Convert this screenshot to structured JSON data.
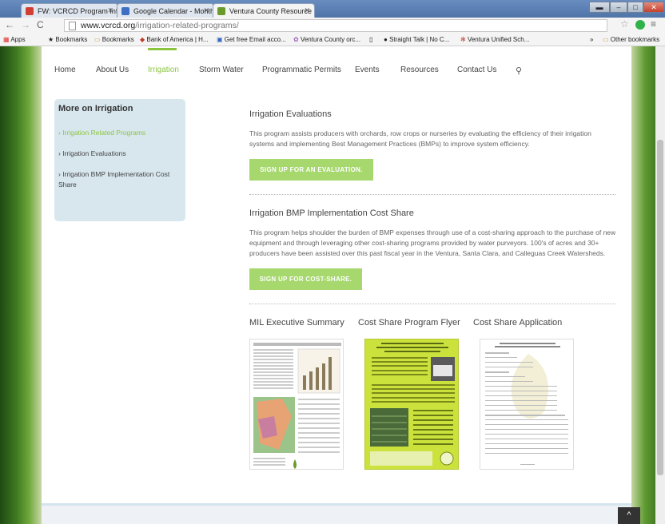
{
  "browser": {
    "tabs": [
      {
        "label": "FW: VCRCD Program Infor",
        "icon": "gmail-icon",
        "color": "#d23f31"
      },
      {
        "label": "Google Calendar - Month",
        "icon": "calendar-icon",
        "color": "#3d6fc4"
      },
      {
        "label": "Ventura County Resource",
        "icon": "leaf-icon",
        "color": "#6a9a2a"
      }
    ],
    "url_host": "www.vcrcd.org",
    "url_path": "/irrigation-related-programs/",
    "bookmarks": [
      "Apps",
      "Bookmarks",
      "Bookmarks",
      "Bank of America | H...",
      "Get free Email acco...",
      "Ventura County orc...",
      "",
      "Straight Talk | No C...",
      "Ventura Unified Sch..."
    ],
    "other_bookmarks": "Other bookmarks",
    "overflow": "»"
  },
  "nav": {
    "items": [
      "Home",
      "About Us",
      "Irrigation",
      "Storm Water",
      "Programmatic Permits",
      "Events",
      "Resources",
      "Contact Us"
    ],
    "active": "Irrigation",
    "accent": "#8cc63f"
  },
  "sidebar": {
    "title": "More on Irrigation",
    "items": [
      "› Irrigation Related Programs",
      "› Irrigation Evaluations",
      "› Irrigation BMP Implementation Cost Share"
    ]
  },
  "sections": [
    {
      "title": "Irrigation Evaluations",
      "body": "This program assists producers with orchards, row crops or nurseries by evaluating the efficiency of their irrigation systems and implementing Best Management Practices (BMPs) to improve system efficiency.",
      "button": "SIGN UP FOR AN EVALUATION."
    },
    {
      "title": "Irrigation BMP Implementation Cost Share",
      "body": "This program helps shoulder the burden of BMP expenses through use of a cost-sharing approach to the purchase of new equipment and through leveraging other cost-sharing programs provided by water purveyors.  100's of acres and 30+ producers have been assisted over this past fiscal year in the Ventura, Santa Clara, and Calleguas Creek Watersheds.",
      "button": "SIGN UP FOR COST-SHARE."
    }
  ],
  "documents": [
    {
      "title": "MIL Executive Summary"
    },
    {
      "title": "Cost Share Program Flyer"
    },
    {
      "title": "Cost Share Application"
    }
  ],
  "to_top": "^"
}
